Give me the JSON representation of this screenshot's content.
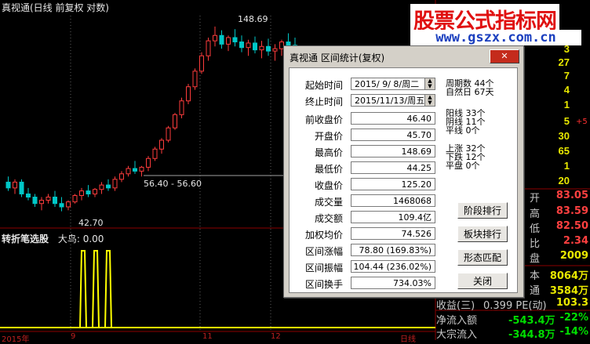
{
  "chart": {
    "title": "真视通(日线 前复权 对数)",
    "high_label": "148.69",
    "low_label": "42.70",
    "range_label": "56.40 - 56.60",
    "indicator_name": "转折笔选股",
    "indicator_param": "大鸟: 0.00",
    "axis_year": "2015年",
    "axis_marks": [
      "9",
      "11",
      "12"
    ],
    "axis_right": "日线"
  },
  "watermark": {
    "title": "股票公式指标网",
    "url": "www.gszx.com.cn"
  },
  "colors": {
    "up": "#ff3c3c",
    "down": "#00c8c8",
    "signal": "#ffff00",
    "dialog_bg": "#d4d0c8"
  },
  "right_panel": {
    "numbers": [
      "3",
      "27",
      "7",
      "4",
      "1",
      "5",
      "30",
      "65",
      "1",
      "20"
    ],
    "plus_mark": "+5",
    "quotes": [
      {
        "key": "开",
        "value": "83.05"
      },
      {
        "key": "高",
        "value": "83.59"
      },
      {
        "key": "低",
        "value": "82.50"
      },
      {
        "key": "比",
        "value": "2.34"
      },
      {
        "key": "盘",
        "value": "2009"
      }
    ],
    "bottom": [
      {
        "key": "本",
        "value": "8064万"
      },
      {
        "key": "通",
        "value": "3584万"
      },
      {
        "key": "收益(三)",
        "value": "0.399 PE(动)",
        "extra": "103.3"
      },
      {
        "key": "净流入额",
        "value": "-543.4万",
        "extra": "-22%"
      },
      {
        "key": "大宗流入",
        "value": "-344.8万",
        "extra": "-14%"
      }
    ]
  },
  "dialog": {
    "title": "真视通 区间统计(复权)",
    "close_label": "✕",
    "fields": [
      {
        "label": "起始时间",
        "value": "2015/ 9/ 8/周二"
      },
      {
        "label": "终止时间",
        "value": "2015/11/13/周五"
      },
      {
        "label": "前收盘价",
        "value": "46.40"
      },
      {
        "label": "开盘价",
        "value": "45.70"
      },
      {
        "label": "最高价",
        "value": "148.69"
      },
      {
        "label": "最低价",
        "value": "44.25"
      },
      {
        "label": "收盘价",
        "value": "125.20"
      },
      {
        "label": "成交量",
        "value": "1468068"
      },
      {
        "label": "成交额",
        "value": "109.4亿"
      },
      {
        "label": "加权均价",
        "value": "74.526"
      },
      {
        "label": "区间涨幅",
        "value": "78.80 (169.83%)"
      },
      {
        "label": "区间振幅",
        "value": "104.44 (236.02%)"
      },
      {
        "label": "区间换手",
        "value": "734.03%"
      }
    ],
    "stats": [
      {
        "label": "周期数",
        "value": "44个"
      },
      {
        "label": "自然日",
        "value": "67天"
      },
      {
        "label": "阳线",
        "value": "33个"
      },
      {
        "label": "阴线",
        "value": "11个"
      },
      {
        "label": "平线",
        "value": "0个"
      },
      {
        "label": "上涨",
        "value": "32个"
      },
      {
        "label": "下跌",
        "value": "12个"
      },
      {
        "label": "平盘",
        "value": "0个"
      }
    ],
    "buttons": [
      "阶段排行",
      "板块排行",
      "形态匹配",
      "关闭"
    ]
  },
  "chart_data": {
    "type": "candlestick",
    "title": "真视通(日线 前复权 对数)",
    "ylim": [
      40,
      160
    ],
    "log_scale": true,
    "series": [
      {
        "name": "price",
        "ohlc": [
          [
            52,
            54,
            49,
            50
          ],
          [
            50,
            53,
            48,
            52
          ],
          [
            52,
            53,
            47,
            48
          ],
          [
            48,
            50,
            46,
            47
          ],
          [
            47,
            48,
            44,
            45
          ],
          [
            45,
            47,
            43,
            46
          ],
          [
            46,
            48,
            45,
            47
          ],
          [
            47,
            49,
            44,
            45
          ],
          [
            45,
            47,
            42.7,
            44
          ],
          [
            44,
            46,
            43,
            45.5
          ],
          [
            45.5,
            48,
            45,
            47.5
          ],
          [
            47.5,
            50,
            46,
            49
          ],
          [
            49,
            51,
            47,
            48
          ],
          [
            48,
            50,
            47,
            49.5
          ],
          [
            49.5,
            52,
            48,
            51
          ],
          [
            51,
            53,
            49,
            50
          ],
          [
            50,
            54,
            49,
            53
          ],
          [
            53,
            56,
            52,
            55
          ],
          [
            55,
            58,
            54,
            57
          ],
          [
            57,
            60,
            55,
            56
          ],
          [
            56,
            58,
            54,
            57.5
          ],
          [
            57.5,
            62,
            56,
            61
          ],
          [
            61,
            66,
            60,
            65
          ],
          [
            65,
            70,
            63,
            69
          ],
          [
            69,
            76,
            68,
            75
          ],
          [
            75,
            83,
            74,
            82
          ],
          [
            82,
            92,
            80,
            90
          ],
          [
            90,
            101,
            88,
            99
          ],
          [
            99,
            112,
            97,
            110
          ],
          [
            110,
            125,
            108,
            122
          ],
          [
            122,
            138,
            118,
            135
          ],
          [
            135,
            148.69,
            130,
            140
          ],
          [
            140,
            145,
            128,
            132
          ],
          [
            132,
            140,
            126,
            138
          ],
          [
            138,
            146,
            130,
            134
          ],
          [
            134,
            140,
            125,
            129
          ],
          [
            129,
            136,
            122,
            133
          ],
          [
            133,
            139,
            124,
            127
          ],
          [
            127,
            135,
            120,
            130
          ],
          [
            130,
            137,
            122,
            126
          ],
          [
            126,
            132,
            118,
            128
          ],
          [
            128,
            136,
            122,
            134
          ],
          [
            134,
            142,
            128,
            131
          ],
          [
            131,
            138,
            124,
            125.2
          ]
        ]
      }
    ],
    "indicator": {
      "name": "转折笔选股",
      "signals": [
        30,
        34,
        38
      ]
    }
  }
}
